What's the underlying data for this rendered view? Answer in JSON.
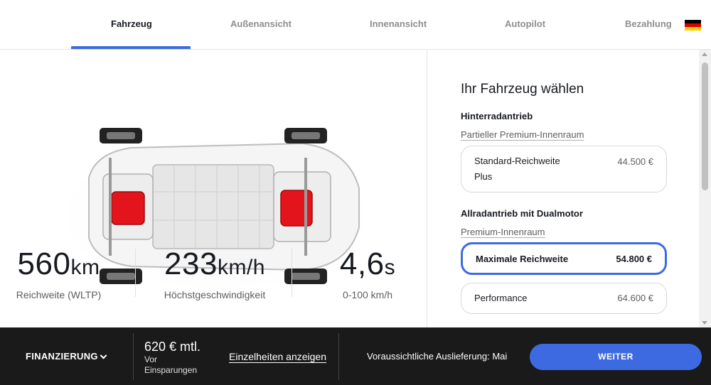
{
  "nav": {
    "tabs": [
      {
        "label": "Fahrzeug",
        "active": true
      },
      {
        "label": "Außenansicht",
        "active": false
      },
      {
        "label": "Innenansicht",
        "active": false
      },
      {
        "label": "Autopilot",
        "active": false
      },
      {
        "label": "Bezahlung",
        "active": false
      }
    ],
    "flag_colors": [
      "#000000",
      "#dd0000",
      "#ffce00"
    ]
  },
  "stats": [
    {
      "value": "560",
      "unit": "km",
      "label": "Reichweite (WLTP)"
    },
    {
      "value": "233",
      "unit": "km/h",
      "label": "Höchstgeschwindigkeit"
    },
    {
      "value": "4,6",
      "unit": "s",
      "label": "0-100 km/h"
    }
  ],
  "panel": {
    "title": "Ihr Fahrzeug wählen",
    "groups": [
      {
        "title": "Hinterradantrieb",
        "subtitle": "Partieller Premium-Innenraum",
        "options": [
          {
            "name_line1": "Standard-Reichweite",
            "name_line2": "Plus",
            "price": "44.500 €",
            "selected": false
          }
        ]
      },
      {
        "title": "Allradantrieb mit Dualmotor",
        "subtitle": "Premium-Innenraum",
        "options": [
          {
            "name": "Maximale Reichweite",
            "price": "54.800 €",
            "selected": true
          },
          {
            "name": "Performance",
            "price": "64.600 €",
            "selected": false
          }
        ]
      }
    ]
  },
  "bottom": {
    "financing_label": "FINANZIERUNG",
    "monthly_price": "620 € mtl.",
    "price_note_line1": "Vor",
    "price_note_line2": "Einsparungen",
    "details_link": "Einzelheiten anzeigen",
    "delivery_text": "Voraussichtliche Auslieferung: Mai",
    "continue_button": "WEITER"
  },
  "colors": {
    "accent": "#3e6ae1",
    "bottom_bar": "#1a1a1a",
    "motor_red": "#e3141c"
  }
}
